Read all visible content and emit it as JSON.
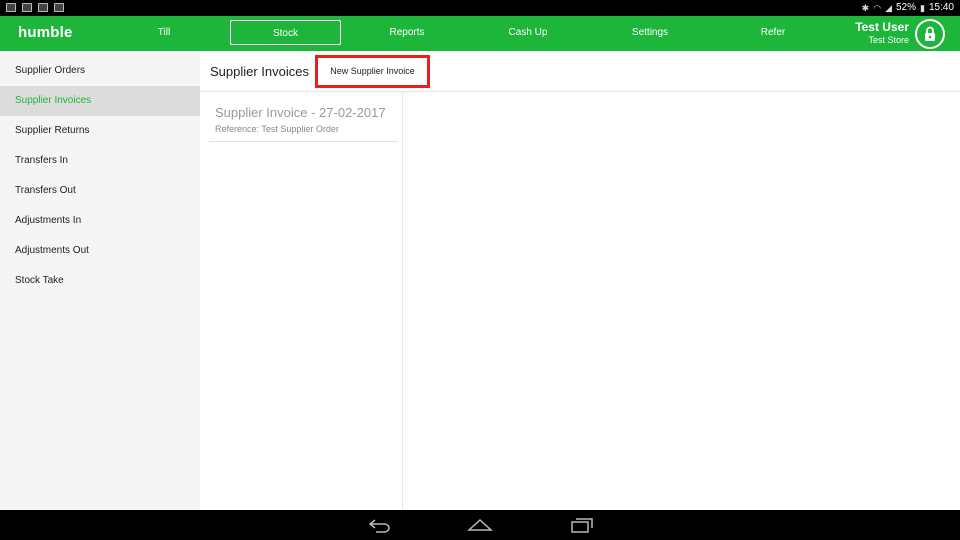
{
  "statusbar": {
    "battery": "52%",
    "time": "15:40"
  },
  "topnav": {
    "brand": "humble",
    "items": [
      "Till",
      "Stock",
      "Reports",
      "Cash Up",
      "Settings",
      "Refer"
    ],
    "active": "Stock",
    "user_name": "Test User",
    "store": "Test Store"
  },
  "sidebar": {
    "items": [
      {
        "label": "Supplier Orders"
      },
      {
        "label": "Supplier Invoices"
      },
      {
        "label": "Supplier Returns"
      },
      {
        "label": "Transfers In"
      },
      {
        "label": "Transfers Out"
      },
      {
        "label": "Adjustments In"
      },
      {
        "label": "Adjustments Out"
      },
      {
        "label": "Stock Take"
      }
    ],
    "active": "Supplier Invoices"
  },
  "main": {
    "title": "Supplier Invoices",
    "new_button": "New Supplier Invoice",
    "invoices": [
      {
        "title": "Supplier Invoice - 27-02-2017",
        "reference": "Reference: Test Supplier Order"
      }
    ]
  },
  "colors": {
    "accent": "#1db53a",
    "highlight": "#e2231a",
    "sidebar_bg": "#f5f5f5"
  },
  "icons": [
    "lock-icon",
    "back-icon",
    "home-icon",
    "recents-icon"
  ]
}
